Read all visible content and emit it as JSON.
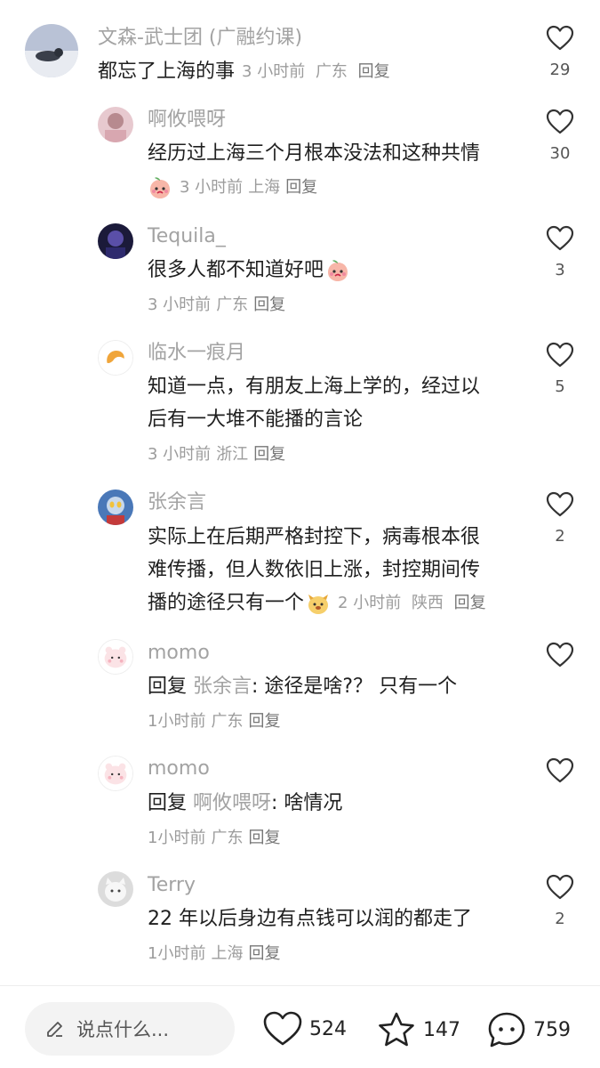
{
  "colors": {
    "username": "#a3a3a3",
    "text": "#1f1f1f",
    "meta": "#9c9c9c",
    "accent_bg": "#f3f3f3"
  },
  "comments": [
    {
      "username": "文森-武士团 (广融约课)",
      "text_lines": [
        "都忘了上海的事"
      ],
      "time": "3 小时前",
      "location": "广东",
      "reply": "回复",
      "likes": "29",
      "avatar_icon": "photo-avatar"
    },
    {
      "username": "啊攸喂呀",
      "text_lines": [
        "经历过上海三个月根本没法和这种共情"
      ],
      "time": "3 小时前",
      "location": "上海",
      "reply": "回复",
      "likes": "30",
      "emoji": "peach-crying-emoji"
    },
    {
      "username": "Tequila_",
      "text_lines": [
        "很多人都不知道好吧"
      ],
      "time": "3 小时前",
      "location": "广东",
      "reply": "回复",
      "likes": "3",
      "emoji": "peach-crying-emoji"
    },
    {
      "username": "临水一痕月",
      "text_lines": [
        "知道一点，有朋友上海上学的，经过以",
        "后有一大堆不能播的言论"
      ],
      "time": "3 小时前",
      "location": "浙江",
      "reply": "回复",
      "likes": "5"
    },
    {
      "username": "张余言",
      "text_lines": [
        "实际上在后期严格封控下，病毒根本很",
        "难传播，但人数依旧上涨，封控期间传",
        "播的途径只有一个"
      ],
      "time": "2 小时前",
      "location": "陕西",
      "reply": "回复",
      "likes": "2",
      "emoji": "dog-emoji"
    },
    {
      "username": "momo",
      "reply_prefix": "回复",
      "reply_to": "张余言",
      "text": ": 途径是啥?？ 只有一个",
      "time": "1小时前",
      "location": "广东",
      "reply": "回复",
      "likes": ""
    },
    {
      "username": "momo",
      "reply_prefix": "回复",
      "reply_to": "啊攸喂呀",
      "text": ": 啥情况",
      "time": "1小时前",
      "location": "广东",
      "reply": "回复",
      "likes": ""
    },
    {
      "username": "Terry",
      "text_lines": [
        "22 年以后身边有点钱可以润的都走了"
      ],
      "time": "1小时前",
      "location": "上海",
      "reply": "回复",
      "likes": "2"
    }
  ],
  "bottom": {
    "placeholder": "说点什么...",
    "likes": "524",
    "favorites": "147",
    "comments": "759"
  }
}
